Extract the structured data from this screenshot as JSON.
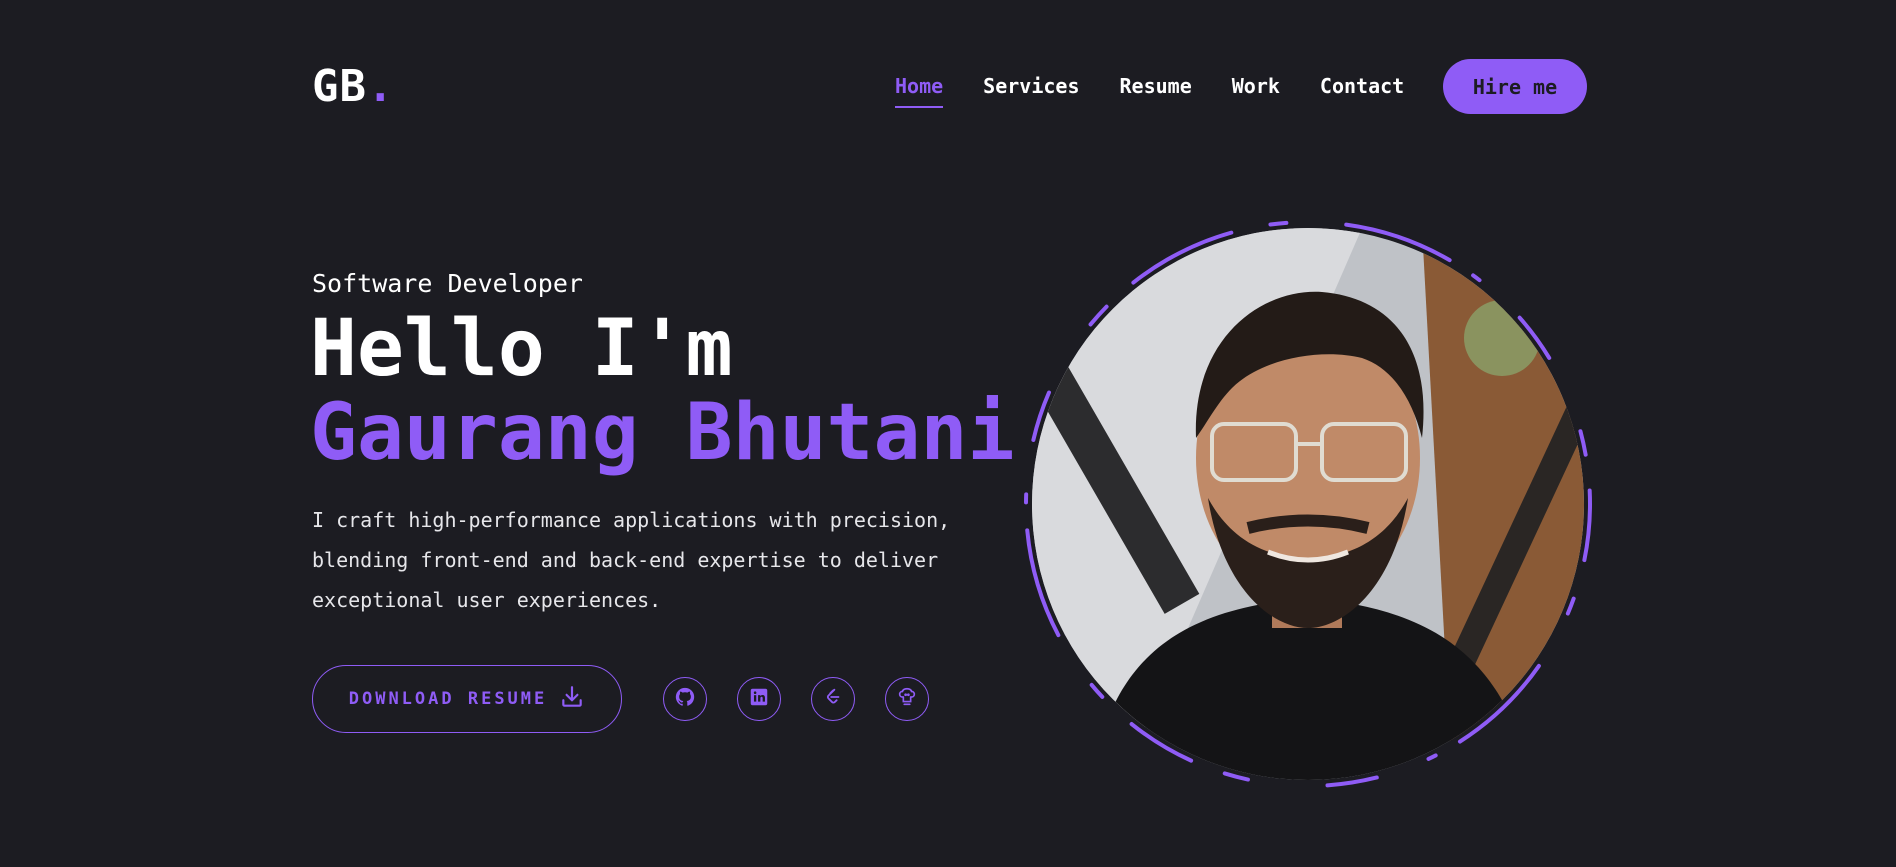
{
  "header": {
    "logo_text": "GB",
    "logo_dot": ".",
    "nav": [
      {
        "label": "Home",
        "active": true
      },
      {
        "label": "Services",
        "active": false
      },
      {
        "label": "Resume",
        "active": false
      },
      {
        "label": "Work",
        "active": false
      },
      {
        "label": "Contact",
        "active": false
      }
    ],
    "hire_label": "Hire me"
  },
  "hero": {
    "role": "Software Developer",
    "greeting": "Hello I'm",
    "name": "Gaurang Bhutani",
    "description": "I craft high-performance applications with precision, blending front-end and back-end expertise to deliver exceptional user experiences.",
    "download_label": "DOWNLOAD RESUME",
    "download_icon": "download-icon",
    "socials": [
      {
        "icon": "github-icon"
      },
      {
        "icon": "linkedin-icon"
      },
      {
        "icon": "leetcode-icon"
      },
      {
        "icon": "codechef-icon"
      }
    ]
  },
  "theme": {
    "accent": "#8f5cf6",
    "background": "#1c1c22",
    "text": "#ffffff"
  }
}
